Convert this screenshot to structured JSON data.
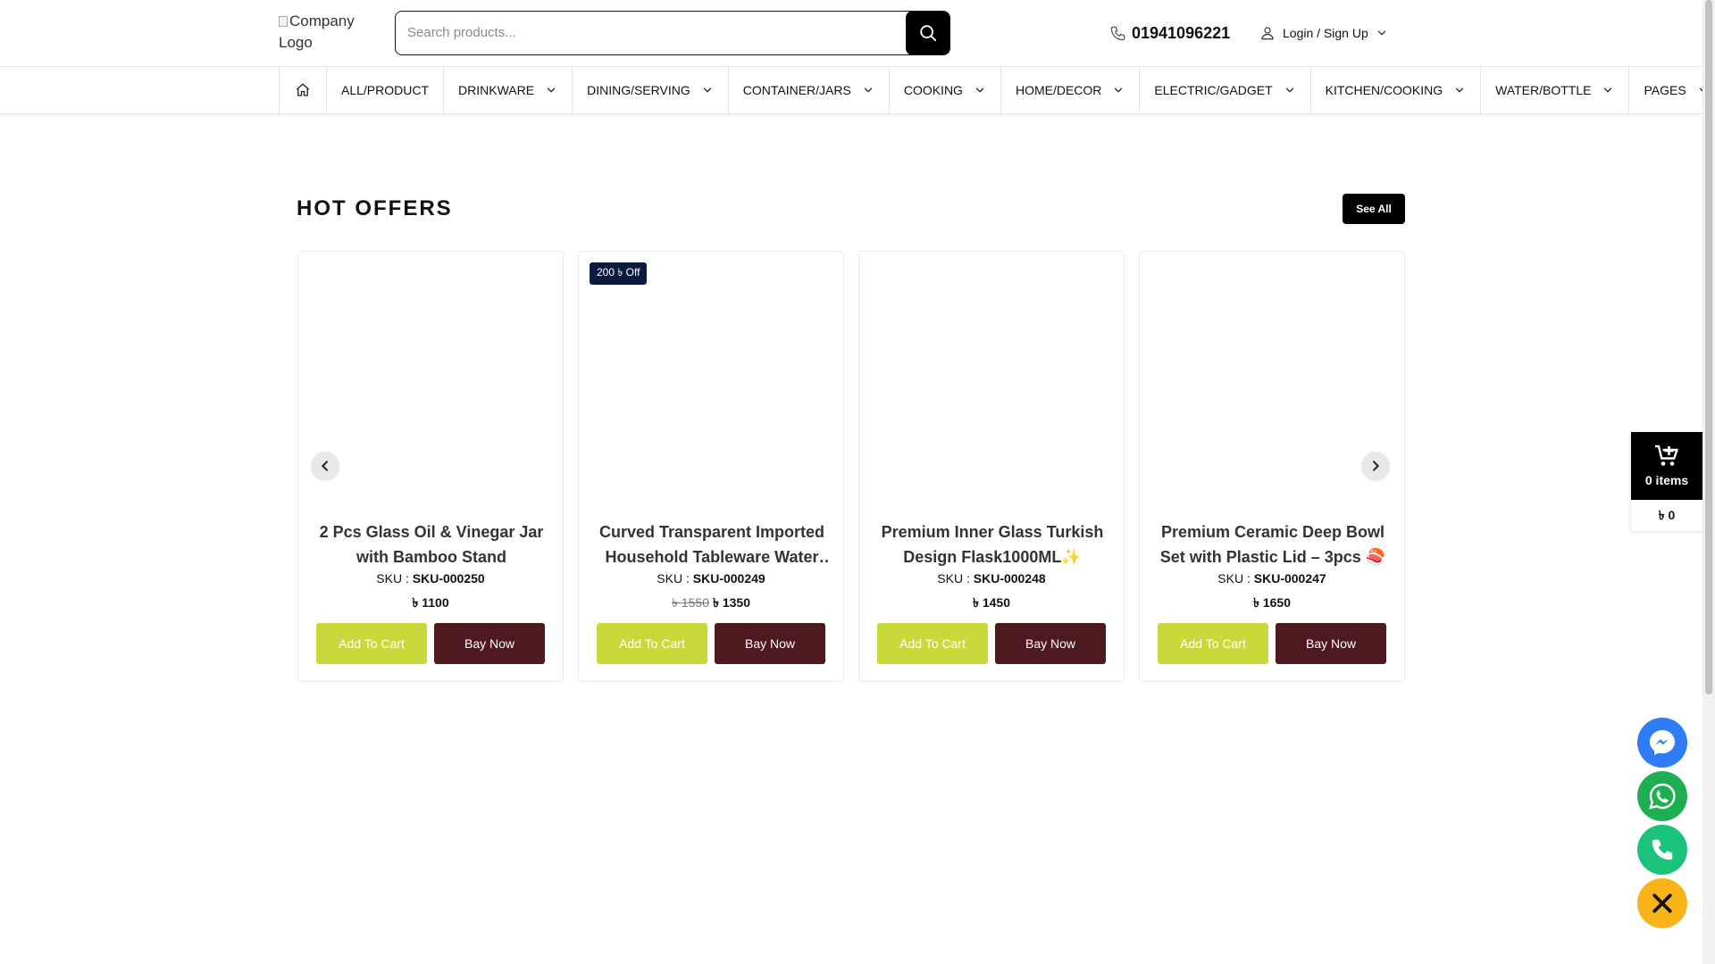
{
  "header": {
    "logo_alt": "Company Logo",
    "search_placeholder": "Search products...",
    "phone": "01941096221",
    "login_label": "Login / Sign Up"
  },
  "nav": {
    "items": [
      {
        "label": "ALL/PRODUCT",
        "has_dropdown": false
      },
      {
        "label": "DRINKWARE",
        "has_dropdown": true
      },
      {
        "label": "DINING/SERVING",
        "has_dropdown": true
      },
      {
        "label": "CONTAINER/JARS",
        "has_dropdown": true
      },
      {
        "label": "COOKING",
        "has_dropdown": true
      },
      {
        "label": "HOME/DECOR",
        "has_dropdown": true
      },
      {
        "label": "ELECTRIC/GADGET",
        "has_dropdown": true
      },
      {
        "label": "KITCHEN/COOKING",
        "has_dropdown": true
      },
      {
        "label": "WATER/BOTTLE",
        "has_dropdown": true
      },
      {
        "label": "PAGES",
        "has_dropdown": true
      }
    ]
  },
  "hot_offers": {
    "title": "HOT OFFERS",
    "see_all_label": "See All",
    "sku_label": "SKU :",
    "add_to_cart_label": "Add To Cart",
    "buy_now_label": "Bay Now",
    "products": [
      {
        "title": "2 Pcs Glass Oil & Vinegar Jar with Bamboo Stand",
        "sku": "SKU-000250",
        "old_price": "",
        "price": "৳ 1100",
        "badge": ""
      },
      {
        "title": "Curved Transparent Imported Household Tableware Water Cup Set",
        "sku": "SKU-000249",
        "old_price": "৳ 1550",
        "price": "৳ 1350",
        "badge": "200 ৳ Off"
      },
      {
        "title": "Premium Inner Glass Turkish Design Flask1000ML✨",
        "sku": "SKU-000248",
        "old_price": "",
        "price": "৳ 1450",
        "badge": ""
      },
      {
        "title": "Premium Ceramic Deep Bowl Set with Plastic Lid – 3pcs 🍣",
        "sku": "SKU-000247",
        "old_price": "",
        "price": "৳ 1650",
        "badge": ""
      }
    ]
  },
  "float_cart": {
    "items_label": "0 items",
    "total": "৳ 0"
  },
  "colors": {
    "add_to_cart_bg": "#c9d93a",
    "buy_now_bg": "#4e1a1f",
    "badge_bg": "#0b1a3e",
    "messenger": "#2e7cf6",
    "whatsapp": "#1fae52",
    "call": "#1bc47d",
    "close": "#f7b318"
  },
  "icons": {
    "search": "search-icon",
    "phone": "phone-icon",
    "user": "user-icon",
    "home": "home-icon",
    "cart": "cart-icon",
    "messenger": "messenger-icon",
    "whatsapp": "whatsapp-icon",
    "call": "call-icon",
    "close": "close-icon"
  }
}
